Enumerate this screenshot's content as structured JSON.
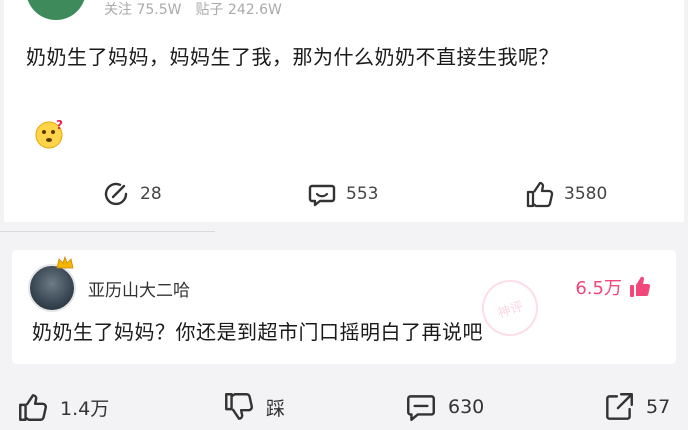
{
  "post": {
    "meta_follow": "关注 75.5W",
    "meta_posts": "贴子 242.6W",
    "text": "奶奶生了妈妈，妈妈生了我，那为什么奶奶不直接生我呢？",
    "emoji": "thinking-face",
    "actions": {
      "share_count": "28",
      "comment_count": "553",
      "like_count": "3580"
    }
  },
  "comment": {
    "username": "亚历山大二哈",
    "likes": "6.5万",
    "text": "奶奶生了妈妈？你还是到超市门口摇明白了再说吧",
    "stamp_text": "神评"
  },
  "bottom_bar": {
    "like_count": "1.4万",
    "dislike_label": "踩",
    "comment_count": "630",
    "share_count": "57"
  },
  "colors": {
    "accent": "#f2477b",
    "background": "#f3f3f5"
  }
}
